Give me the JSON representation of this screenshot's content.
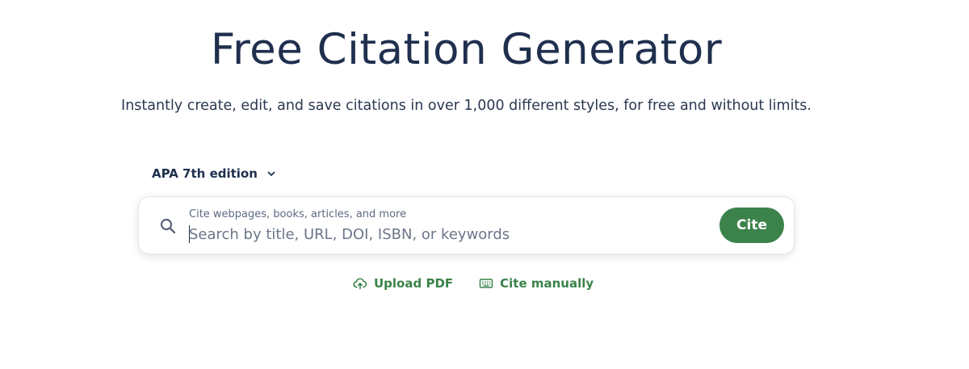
{
  "header": {
    "title": "Free Citation Generator",
    "subtitle": "Instantly create, edit, and save citations in over 1,000 different styles, for free and without limits."
  },
  "style_selector": {
    "selected": "APA 7th edition",
    "icon": "chevron-down-icon"
  },
  "search": {
    "hint": "Cite webpages, books, articles, and more",
    "placeholder": "Search by title, URL, DOI, ISBN, or keywords",
    "value": "",
    "icon": "search-icon",
    "button_label": "Cite"
  },
  "actions": {
    "upload_pdf": {
      "label": "Upload PDF",
      "icon": "cloud-upload-icon"
    },
    "cite_manually": {
      "label": "Cite manually",
      "icon": "keyboard-icon"
    }
  },
  "colors": {
    "primary_text": "#1f2f4e",
    "accent_green": "#3b834a",
    "muted_text": "#5d6a80"
  }
}
